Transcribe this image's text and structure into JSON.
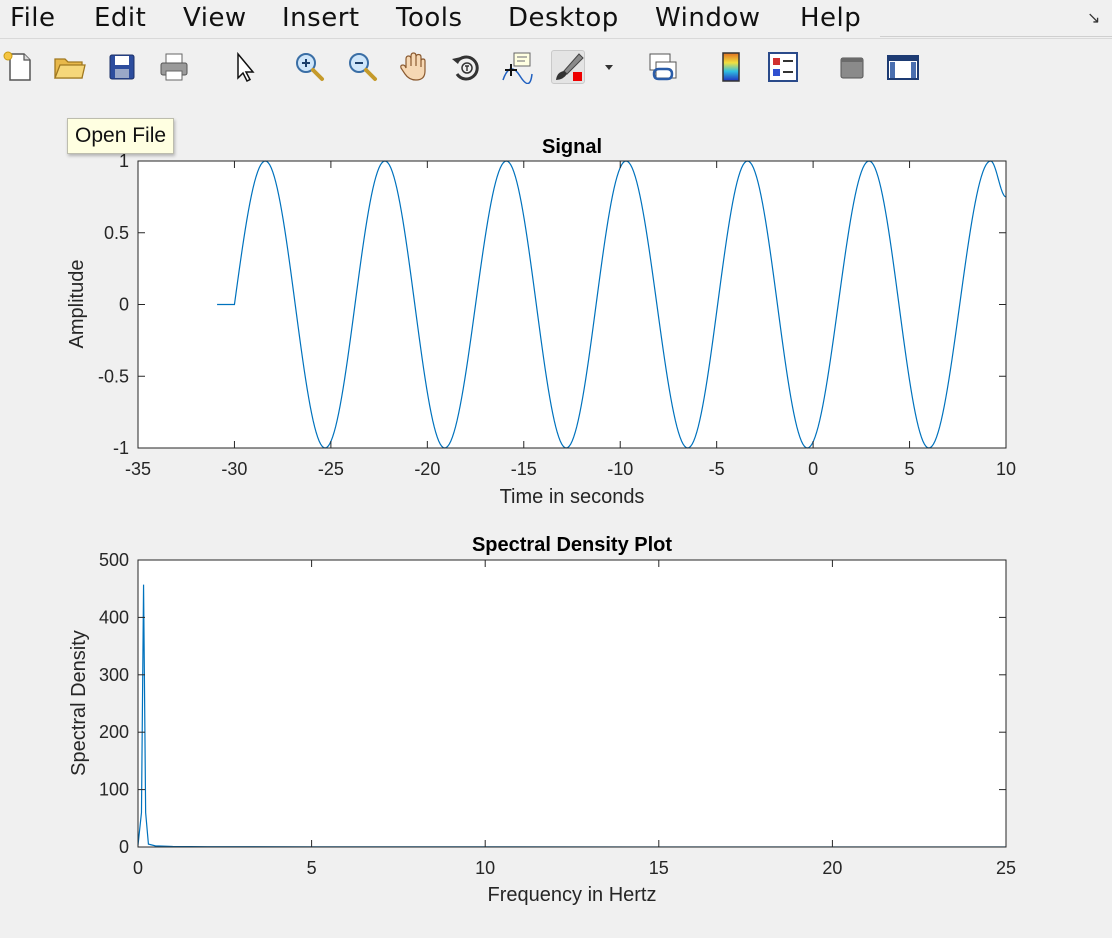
{
  "menu": [
    "File",
    "Edit",
    "View",
    "Insert",
    "Tools",
    "Desktop",
    "Window",
    "Help"
  ],
  "toolbar": {
    "buttons": [
      {
        "name": "new-figure-icon"
      },
      {
        "name": "open-file-icon"
      },
      {
        "name": "save-icon"
      },
      {
        "name": "print-icon"
      },
      {
        "name": "edit-plot-arrow-icon"
      },
      {
        "name": "zoom-in-icon"
      },
      {
        "name": "zoom-out-icon"
      },
      {
        "name": "pan-hand-icon"
      },
      {
        "name": "rotate-3d-icon"
      },
      {
        "name": "data-cursor-icon"
      },
      {
        "name": "brush-icon"
      },
      {
        "name": "brush-dropdown-icon"
      },
      {
        "name": "link-plot-icon"
      },
      {
        "name": "insert-colorbar-icon"
      },
      {
        "name": "insert-legend-icon"
      },
      {
        "name": "hide-plot-tools-icon"
      },
      {
        "name": "show-plot-tools-icon"
      }
    ]
  },
  "tooltip": {
    "text": "Open File"
  },
  "colors": {
    "line": "#0072bd",
    "tooltip_bg": "#ffffe1",
    "background": "#f0f0f0"
  },
  "chart_data": [
    {
      "type": "line",
      "title": "Signal",
      "xlabel": "Time in seconds",
      "ylabel": "Amplitude",
      "xlim": [
        -35,
        10
      ],
      "ylim": [
        -1,
        1
      ],
      "xticks": [
        -35,
        -30,
        -25,
        -20,
        -15,
        -10,
        -5,
        0,
        5,
        10
      ],
      "xtick_labels": [
        "-35",
        "-30",
        "-25",
        "-20",
        "-15",
        "-10",
        "-5",
        "0",
        "5",
        "10"
      ],
      "yticks": [
        -1,
        -0.5,
        0,
        0.5,
        1
      ],
      "ytick_labels": [
        "-1",
        "-0.5",
        "0",
        "0.5",
        "1"
      ],
      "grid": false,
      "series": [
        {
          "x": [
            -30.9,
            -30.0,
            -28.4,
            -25.3,
            -22.2,
            -19.1,
            -15.9,
            -12.8,
            -9.7,
            -6.5,
            -3.4,
            -0.3,
            2.9,
            6.0,
            9.2,
            10.0
          ],
          "y": [
            0,
            0,
            1,
            -1,
            1,
            -1,
            1,
            -1,
            1,
            -1,
            1,
            -1,
            1,
            -1,
            1,
            0.75
          ]
        }
      ]
    },
    {
      "type": "line",
      "title": "Spectral Density Plot",
      "xlabel": "Frequency in Hertz",
      "ylabel": "Spectral Density",
      "xlim": [
        0,
        25
      ],
      "ylim": [
        0,
        500
      ],
      "xticks": [
        0,
        5,
        10,
        15,
        20,
        25
      ],
      "xtick_labels": [
        "0",
        "5",
        "10",
        "15",
        "20",
        "25"
      ],
      "yticks": [
        0,
        100,
        200,
        300,
        400,
        500
      ],
      "ytick_labels": [
        "0",
        "100",
        "200",
        "300",
        "400",
        "500"
      ],
      "grid": false,
      "series": [
        {
          "x": [
            0,
            0.1,
            0.16,
            0.22,
            0.3,
            0.5,
            1,
            2,
            5,
            10,
            15,
            20,
            25
          ],
          "y": [
            3,
            60,
            457,
            60,
            5,
            2,
            1,
            0.5,
            0.3,
            0.2,
            0.1,
            0.1,
            0.1
          ]
        }
      ]
    }
  ]
}
